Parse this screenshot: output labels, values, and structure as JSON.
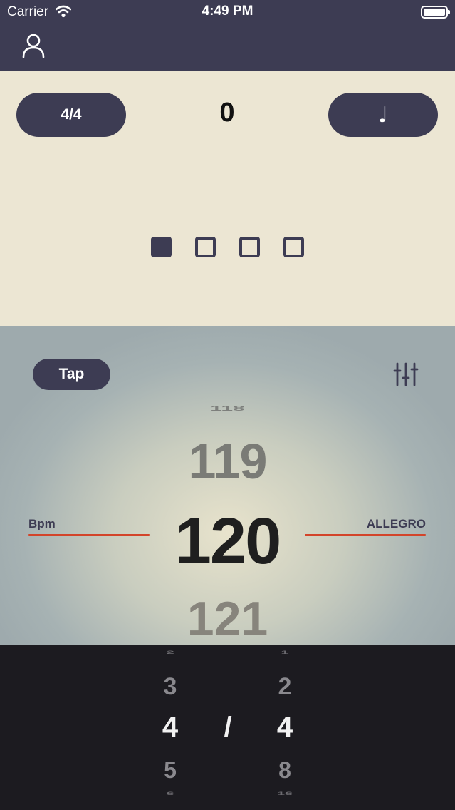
{
  "status_bar": {
    "carrier": "Carrier",
    "time": "4:49 PM"
  },
  "nav": {
    "profile_icon": "person-icon"
  },
  "header": {
    "time_signature_label": "4/4",
    "count": "0",
    "note_value_label": "♩"
  },
  "beats": {
    "total": 4,
    "active_index": 0
  },
  "tempo": {
    "tap_label": "Tap",
    "settings_icon": "sliders-icon",
    "bpm_label": "Bpm",
    "tempo_name": "ALLEGRO",
    "values": [
      "118",
      "119",
      "120",
      "121"
    ],
    "selected": "120"
  },
  "picker": {
    "numerator": {
      "above_cut": "2",
      "above": "3",
      "selected": "4",
      "below": "5",
      "below_cut": "6"
    },
    "separator": "/",
    "denominator": {
      "above_cut": "1",
      "above": "2",
      "selected": "4",
      "below": "8",
      "below_cut": "16"
    }
  },
  "colors": {
    "navy": "#3d3c53",
    "cream": "#ece6d3",
    "accent_red": "#d3442a",
    "dark": "#1c1b20"
  }
}
